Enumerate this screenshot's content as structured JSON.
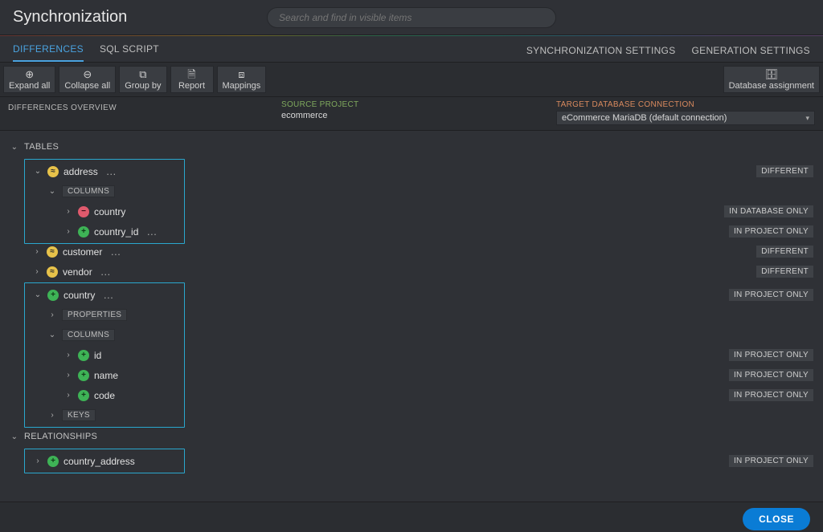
{
  "header": {
    "title": "Synchronization",
    "search_placeholder": "Search and find in visible items"
  },
  "tabs": {
    "left": [
      {
        "label": "DIFFERENCES",
        "active": true
      },
      {
        "label": "SQL SCRIPT",
        "active": false
      }
    ],
    "right": [
      {
        "label": "SYNCHRONIZATION SETTINGS"
      },
      {
        "label": "GENERATION SETTINGS"
      }
    ]
  },
  "toolbar": {
    "expand_all": "Expand all",
    "collapse_all": "Collapse all",
    "group_by": "Group by",
    "report": "Report",
    "mappings": "Mappings",
    "db_assignment": "Database assignment"
  },
  "meta": {
    "overview_label": "DIFFERENCES OVERVIEW",
    "source_label": "SOURCE PROJECT",
    "source_value": "ecommerce",
    "target_label": "TARGET DATABASE CONNECTION",
    "target_value": "eCommerce MariaDB (default connection)"
  },
  "badges": {
    "different": "DIFFERENT",
    "in_database_only": "IN DATABASE ONLY",
    "in_project_only": "IN PROJECT ONLY"
  },
  "sections": {
    "tables": "TABLES",
    "columns": "COLUMNS",
    "properties": "PROPERTIES",
    "keys": "KEYS",
    "relationships": "RELATIONSHIPS"
  },
  "tree": {
    "address": {
      "label": "address",
      "status_badge": "DIFFERENT",
      "columns": {
        "country": {
          "label": "country",
          "status_badge": "IN DATABASE ONLY"
        },
        "country_id": {
          "label": "country_id",
          "status_badge": "IN PROJECT ONLY"
        }
      }
    },
    "customer": {
      "label": "customer",
      "status_badge": "DIFFERENT"
    },
    "vendor": {
      "label": "vendor",
      "status_badge": "DIFFERENT"
    },
    "country": {
      "label": "country",
      "status_badge": "IN PROJECT ONLY",
      "columns": {
        "id": {
          "label": "id",
          "status_badge": "IN PROJECT ONLY"
        },
        "name": {
          "label": "name",
          "status_badge": "IN PROJECT ONLY"
        },
        "code": {
          "label": "code",
          "status_badge": "IN PROJECT ONLY"
        }
      }
    },
    "country_address": {
      "label": "country_address",
      "status_badge": "IN PROJECT ONLY"
    }
  },
  "footer": {
    "close": "CLOSE"
  },
  "glyphs": {
    "expand": "⊕",
    "collapse": "⊖",
    "group": "⧉",
    "report": "🗎",
    "mappings": "⧈",
    "db": "🗄",
    "plus": "+",
    "minus": "−",
    "change": "≈",
    "more": "…"
  }
}
